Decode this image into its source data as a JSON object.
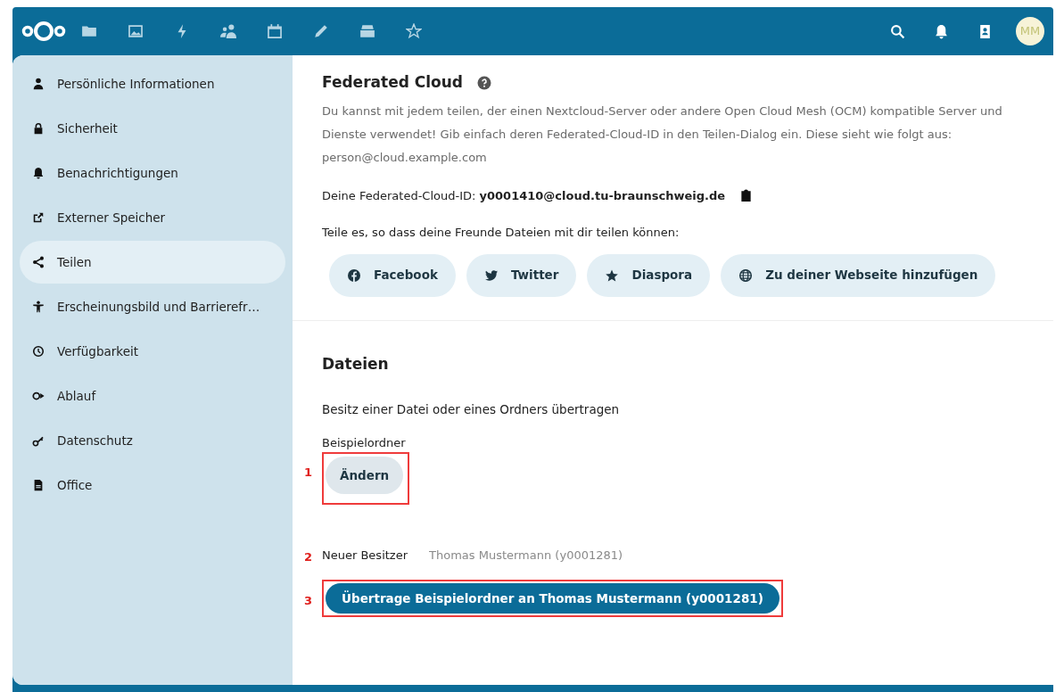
{
  "header": {
    "apps": [
      {
        "kind": "files"
      },
      {
        "kind": "photos"
      },
      {
        "kind": "activity"
      },
      {
        "kind": "contacts"
      },
      {
        "kind": "calendar"
      },
      {
        "kind": "notes"
      },
      {
        "kind": "deck"
      },
      {
        "kind": "star"
      }
    ],
    "actions": [
      {
        "kind": "search"
      },
      {
        "kind": "bell"
      },
      {
        "kind": "contact-card"
      }
    ],
    "avatar": "MM"
  },
  "sidebar": {
    "items": [
      {
        "label": "Persönliche Informationen",
        "kind": "person",
        "selected": false
      },
      {
        "label": "Sicherheit",
        "kind": "lock",
        "selected": false
      },
      {
        "label": "Benachrichtigungen",
        "kind": "bell",
        "selected": false
      },
      {
        "label": "Externer Speicher",
        "kind": "external",
        "selected": false
      },
      {
        "label": "Teilen",
        "kind": "share",
        "selected": true
      },
      {
        "label": "Erscheinungsbild und Barrierefr…",
        "kind": "accessibility",
        "selected": false
      },
      {
        "label": "Verfügbarkeit",
        "kind": "clock",
        "selected": false
      },
      {
        "label": "Ablauf",
        "kind": "flow",
        "selected": false
      },
      {
        "label": "Datenschutz",
        "kind": "key",
        "selected": false
      },
      {
        "label": "Office",
        "kind": "document",
        "selected": false
      }
    ]
  },
  "federated": {
    "title": "Federated Cloud",
    "description": "Du kannst mit jedem teilen, der einen Nextcloud-Server oder andere Open Cloud Mesh (OCM) kompatible Server und Dienste verwendet! Gib einfach deren Federated-Cloud-ID in den Teilen-Dialog ein. Diese sieht wie folgt aus: person@cloud.example.com",
    "id_line": "Deine Federated-Cloud-ID: **y0001410@cloud.tu-braunschweig.de**",
    "share_hint": "Teile es, so dass deine Freunde Dateien mit dir teilen können:",
    "share_buttons": [
      {
        "label": "Facebook",
        "kind": "facebook"
      },
      {
        "label": "Twitter",
        "kind": "twitter"
      },
      {
        "label": "Diaspora",
        "kind": "star"
      },
      {
        "label": "Zu deiner Webseite hinzufügen",
        "kind": "globe"
      }
    ]
  },
  "files": {
    "title": "Dateien",
    "subtitle": "Besitz einer Datei oder eines Ordners übertragen",
    "folder": "Beispielordner",
    "change_button": "Ändern",
    "change_annotation": "1",
    "owner_label": "Neuer Besitzer",
    "owner_placeholder": "Thomas Mustermann (y0001281)",
    "owner_annotation": "2",
    "transfer_button": "Übertrage Beispielordner an Thomas Mustermann (y0001281)",
    "transfer_annotation": "3"
  }
}
